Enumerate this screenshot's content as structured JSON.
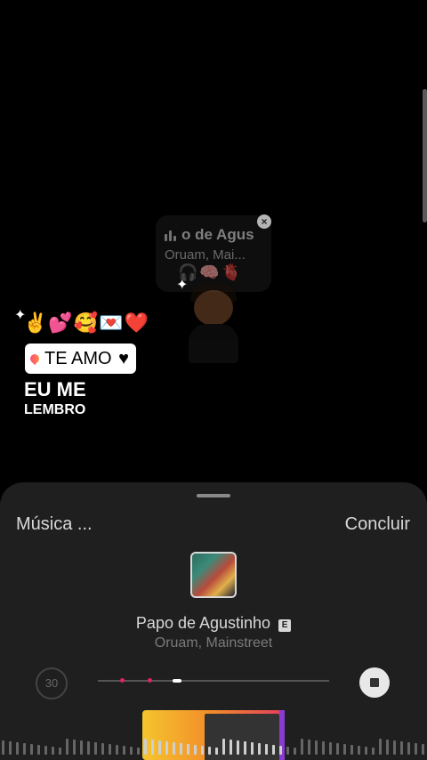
{
  "story": {
    "music_sticker": {
      "track_short": "o de Agus",
      "artist_short": "Oruam, Mai..."
    },
    "emoji_text": "✌️💕🥰💌❤️",
    "stickers": {
      "te_amo": "TE AMO",
      "eu_me": "EU ME",
      "lembro": "LEMBRO"
    }
  },
  "sheet": {
    "title": "Música ...",
    "done": "Concluir",
    "song_title": "Papo de Agustinho",
    "explicit_badge": "E",
    "artist": "Oruam, Mainstreet",
    "duration": "30"
  },
  "colors": {
    "accent": "#e0245e",
    "selector_start": "#f5c52d",
    "selector_end": "#e53d5d",
    "rim": "#8a3bd1"
  },
  "icons": [
    "close-icon",
    "stop-icon",
    "explicit-icon",
    "location-pin-icon",
    "heart-icon",
    "sparkle-icon"
  ]
}
